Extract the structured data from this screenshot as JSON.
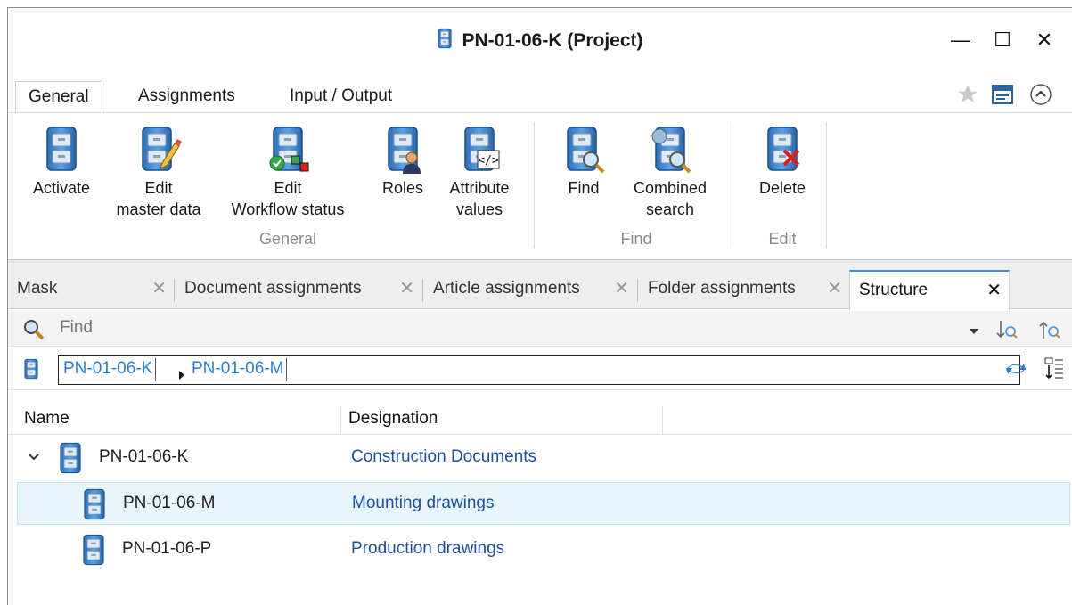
{
  "window": {
    "title": "PN-01-06-K (Project)",
    "minimize_glyph": "—",
    "maximize_glyph": "☐",
    "close_glyph": "✕"
  },
  "ribbon_tabs": [
    "General",
    "Assignments",
    "Input / Output"
  ],
  "ribbon_buttons": {
    "activate": "Activate",
    "edit_master_1": "Edit",
    "edit_master_2": "master data",
    "edit_workflow_1": "Edit",
    "edit_workflow_2": "Workflow status",
    "roles": "Roles",
    "attr_1": "Attribute",
    "attr_2": "values",
    "find": "Find",
    "combined_1": "Combined",
    "combined_2": "search",
    "delete": "Delete"
  },
  "ribbon_groups": [
    "General",
    "Find",
    "Edit"
  ],
  "doc_tabs": [
    {
      "label": "Mask"
    },
    {
      "label": "Document assignments"
    },
    {
      "label": "Article assignments"
    },
    {
      "label": "Folder assignments"
    },
    {
      "label": "Structure",
      "active": true
    }
  ],
  "find": {
    "placeholder": "Find"
  },
  "breadcrumb": [
    "PN-01-06-K",
    "PN-01-06-M"
  ],
  "table": {
    "columns": [
      "Name",
      "Designation"
    ],
    "rows": [
      {
        "name": "PN-01-06-K",
        "designation": "Construction Documents",
        "expanded": true,
        "level": 0
      },
      {
        "name": "PN-01-06-M",
        "designation": "Mounting drawings",
        "level": 1,
        "selected": true
      },
      {
        "name": "PN-01-06-P",
        "designation": "Production drawings",
        "level": 1
      }
    ]
  },
  "colors": {
    "accent": "#3b8fd9",
    "link": "#2a7fd4",
    "designation": "#1f4e9c",
    "selected_row": "#e6f6fb"
  },
  "icons": [
    "cabinet-icon",
    "star-icon",
    "window-icon",
    "collapse-ribbon-icon",
    "search-icon",
    "dropdown-icon",
    "sort-asc-icon",
    "sort-desc-icon",
    "sync-icon",
    "tree-options-icon"
  ]
}
